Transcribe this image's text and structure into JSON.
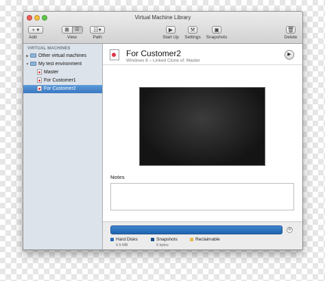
{
  "window": {
    "title": "Virtual Machine Library"
  },
  "toolbar": {
    "add_label": "Add",
    "add_glyph": "+ ▾",
    "view_label": "View",
    "path_label": "Path",
    "start_up_label": "Start Up",
    "settings_label": "Settings",
    "snapshots_label": "Snapshots",
    "delete_label": "Delete"
  },
  "sidebar": {
    "header": "VIRTUAL MACHINES",
    "items": [
      {
        "label": "Other virtual machines",
        "icon": "folder-icon",
        "expanded": false
      },
      {
        "label": "My test environment",
        "icon": "folder-icon",
        "expanded": true
      },
      {
        "label": "Master",
        "icon": "vm-icon"
      },
      {
        "label": "For Customer1",
        "icon": "vm-icon"
      },
      {
        "label": "For Customer2",
        "icon": "vm-icon",
        "selected": true
      }
    ]
  },
  "vm": {
    "name": "For Customer2",
    "subtitle": "Windows 8 – Linked Clone of: Master"
  },
  "notes": {
    "label": "Notes",
    "value": ""
  },
  "usage": {
    "legend": [
      {
        "label": "Hard Disks",
        "size": "9.5 MB",
        "color": "#2a6cb8"
      },
      {
        "label": "Snapshots",
        "size": "0 bytes",
        "color": "#1d4f8a"
      },
      {
        "label": "Reclaimable",
        "size": "",
        "color": "#e8b84a"
      }
    ]
  },
  "colors": {
    "selection": "#3a78c2",
    "usage_bar": "#2f74c0"
  }
}
